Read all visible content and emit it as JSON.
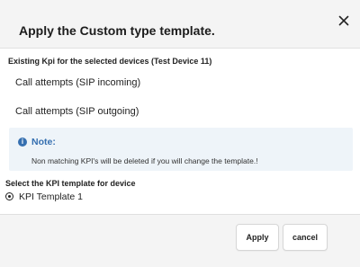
{
  "dialog": {
    "title": "Apply the Custom type template.",
    "close_icon": "close-icon"
  },
  "kpi_section": {
    "heading": "Existing Kpi for the selected devices (Test Device 11)",
    "items": [
      "Call attempts (SIP incoming)",
      "Call attempts (SIP outgoing)"
    ]
  },
  "note": {
    "icon": "info-icon",
    "title": "Note:",
    "text": "Non matching KPI's will be deleted if you will change the template.!",
    "accent_color": "#356fb0",
    "background_color": "#eef4f9"
  },
  "template_section": {
    "heading": "Select the KPI template for device",
    "options": [
      {
        "label": "KPI Template 1",
        "selected": true
      }
    ]
  },
  "footer": {
    "apply_label": "Apply",
    "cancel_label": "cancel"
  }
}
